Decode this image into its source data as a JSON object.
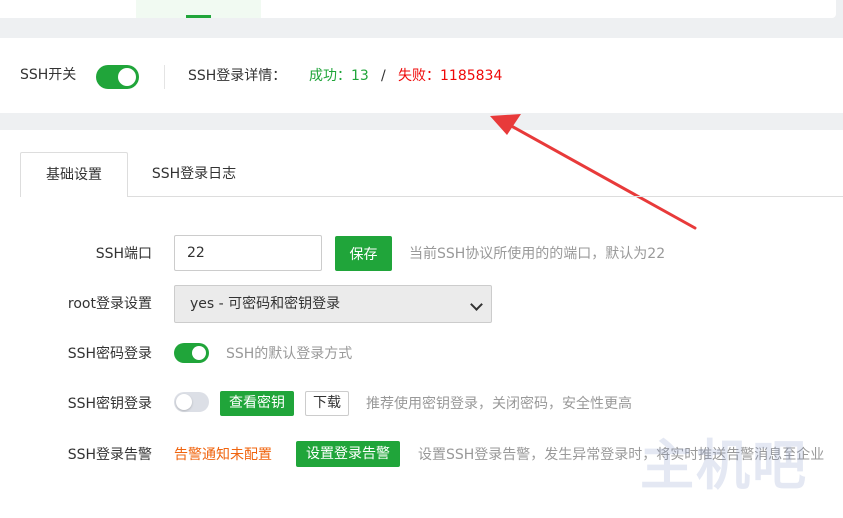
{
  "status": {
    "ssh_switch_label": "SSH开关",
    "ssh_enabled": true,
    "login_detail_label": "SSH登录详情：",
    "success_text": "成功：13",
    "separator": "/",
    "fail_text": "失败：1185834"
  },
  "tabs": [
    {
      "label": "基础设置",
      "active": true
    },
    {
      "label": "SSH登录日志",
      "active": false
    }
  ],
  "settings": {
    "port": {
      "label": "SSH端口",
      "value": "22",
      "save_label": "保存",
      "hint": "当前SSH协议所使用的的端口，默认为22"
    },
    "root_login": {
      "label": "root登录设置",
      "selected": "yes - 可密码和密钥登录"
    },
    "password_login": {
      "label": "SSH密码登录",
      "enabled": true,
      "hint": "SSH的默认登录方式"
    },
    "key_login": {
      "label": "SSH密钥登录",
      "enabled": false,
      "view_label": "查看密钥",
      "download_label": "下载",
      "hint": "推荐使用密钥登录，关闭密码，安全性更高"
    },
    "alarm": {
      "label": "SSH登录告警",
      "status": "告警通知未配置",
      "button_label": "设置登录告警",
      "hint": "设置SSH登录告警，发生异常登录时，将实时推送告警消息至企业"
    }
  },
  "watermark": "主机吧",
  "colors": {
    "accent_green": "#20a53a",
    "fail_red": "#ef0808",
    "warning_orange": "#f0640e",
    "arrow_red": "#e83a3a"
  }
}
